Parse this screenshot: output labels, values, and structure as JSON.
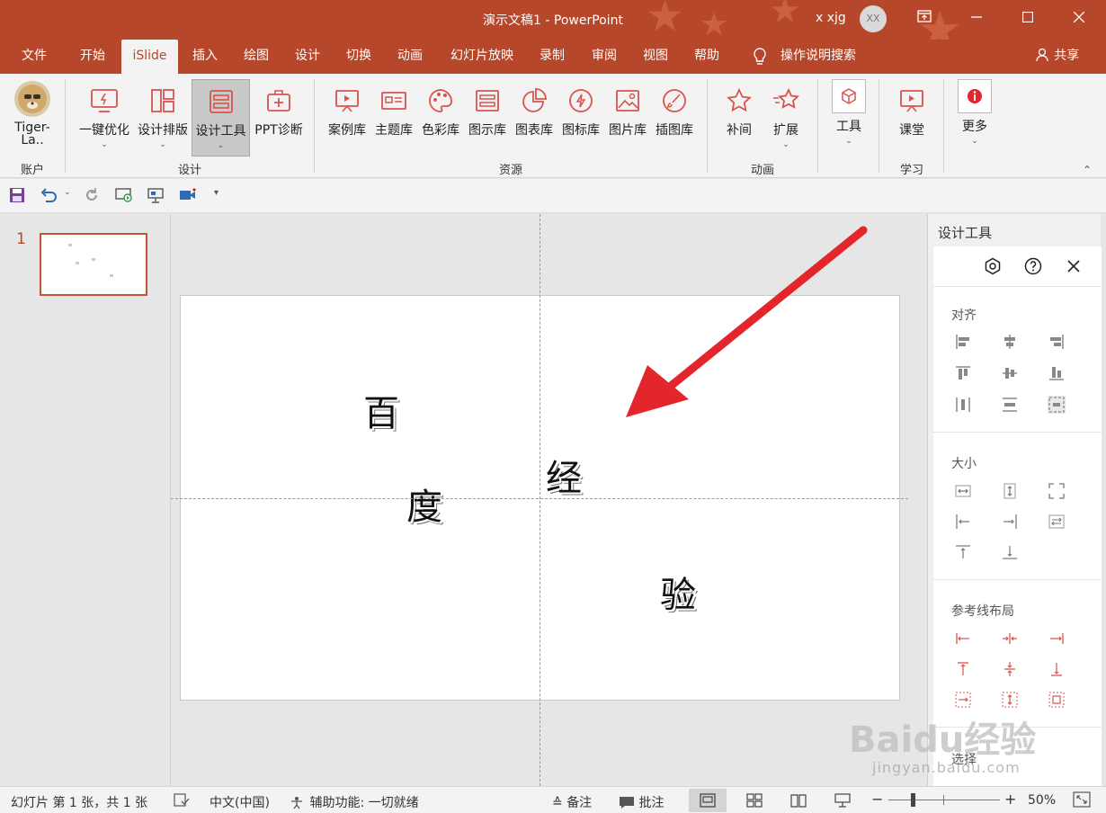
{
  "window": {
    "title": "演示文稿1  -  PowerPoint",
    "user": "x xjg",
    "avatar_initials": "XX",
    "minimize_icon": "minimize-icon",
    "maximize_icon": "maximize-icon",
    "close_icon": "close-icon",
    "restore_icon": "ribbon-display-icon"
  },
  "tabs": [
    "文件",
    "开始",
    "iSlide",
    "插入",
    "绘图",
    "设计",
    "切换",
    "动画",
    "幻灯片放映",
    "录制",
    "审阅",
    "视图",
    "帮助"
  ],
  "tell_me": "操作说明搜索",
  "share": "共享",
  "ribbon": {
    "account": {
      "name_line1": "Tiger-",
      "name_line2": "La..",
      "group": "账户"
    },
    "design": {
      "group": "设计",
      "buttons": [
        "一键优化",
        "设计排版",
        "设计工具",
        "PPT诊断"
      ]
    },
    "resources": {
      "group": "资源",
      "buttons": [
        "案例库",
        "主题库",
        "色彩库",
        "图示库",
        "图表库",
        "图标库",
        "图片库",
        "插图库"
      ]
    },
    "animation": {
      "group": "动画",
      "buttons": [
        "补间",
        "扩展"
      ]
    },
    "tools": {
      "button": "工具"
    },
    "learn": {
      "group": "学习",
      "button": "课堂"
    },
    "more": {
      "button": "更多"
    }
  },
  "slides_panel": {
    "number": "1"
  },
  "slide": {
    "chars": [
      "百",
      "度",
      "经",
      "验"
    ]
  },
  "design_pane": {
    "title": "设计工具",
    "align": "对齐",
    "size": "大小",
    "guides": "参考线布局",
    "select": "选择"
  },
  "status": {
    "slide_info": "幻灯片 第 1 张，共 1 张",
    "language": "中文(中国)",
    "accessibility": "辅助功能: 一切就绪",
    "notes": "备注",
    "comments": "批注",
    "zoom_minus": "−",
    "zoom_plus": "+",
    "zoom": "50%"
  },
  "watermark": {
    "brand": "Baidu经验",
    "url": "jingyan.baidu.com"
  },
  "colors": {
    "accent": "#b7472a",
    "icon_red": "#d9534f",
    "arrow": "#e3262c"
  }
}
